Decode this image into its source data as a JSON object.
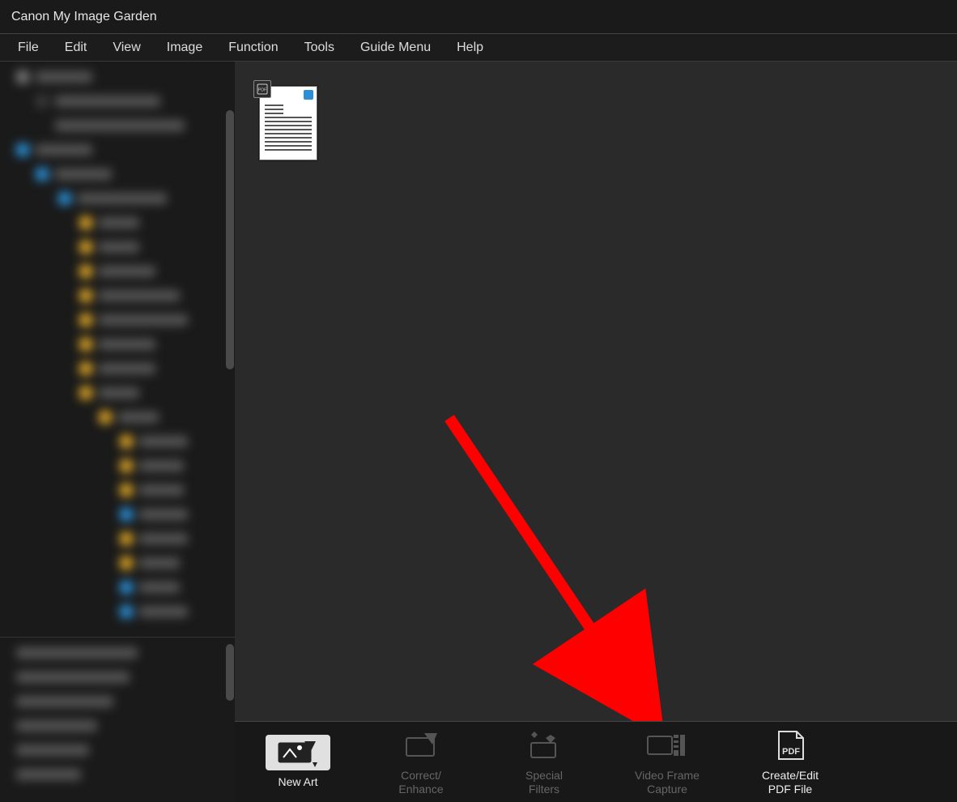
{
  "window": {
    "title": "Canon My Image Garden"
  },
  "menubar": {
    "items": [
      {
        "label": "File"
      },
      {
        "label": "Edit"
      },
      {
        "label": "View"
      },
      {
        "label": "Image"
      },
      {
        "label": "Function"
      },
      {
        "label": "Tools"
      },
      {
        "label": "Guide Menu"
      },
      {
        "label": "Help"
      }
    ]
  },
  "thumbnail": {
    "badge": "PDF"
  },
  "toolbar": {
    "items": [
      {
        "label": "New Art",
        "icon": "new-art-icon",
        "active": true,
        "enabled": true
      },
      {
        "label": "Correct/\nEnhance",
        "icon": "correct-enhance-icon",
        "active": false,
        "enabled": false
      },
      {
        "label": "Special\nFilters",
        "icon": "special-filters-icon",
        "active": false,
        "enabled": false
      },
      {
        "label": "Video Frame\nCapture",
        "icon": "video-capture-icon",
        "active": false,
        "enabled": false
      },
      {
        "label": "Create/Edit\nPDF File",
        "icon": "pdf-icon",
        "active": false,
        "enabled": true
      }
    ]
  },
  "annotation": {
    "arrow_color": "#ff0000"
  }
}
